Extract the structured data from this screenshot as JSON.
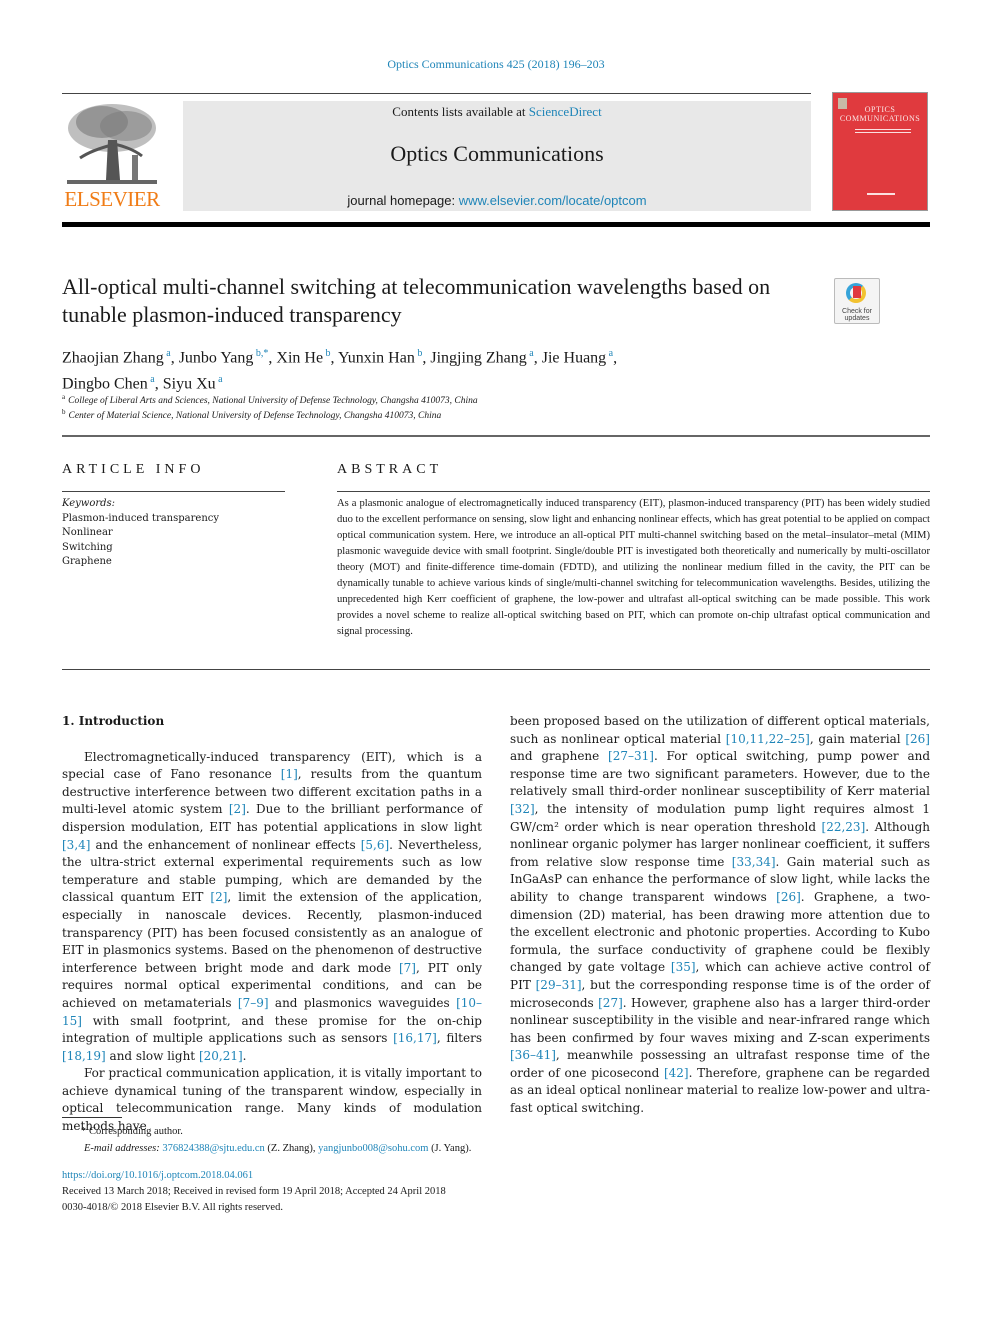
{
  "header": {
    "journal_ref": "Optics Communications 425 (2018) 196–203",
    "contents_prefix": "Contents lists available at ",
    "contents_link": "ScienceDirect",
    "journal_title": "Optics Communications",
    "homepage_prefix": "journal homepage: ",
    "homepage_link": "www.elsevier.com/locate/optcom",
    "publisher_logo": "ELSEVIER",
    "cover_title_line1": "OPTICS",
    "cover_title_line2": "COMMUNICATIONS"
  },
  "crossmark": {
    "label_line1": "Check for",
    "label_line2": "updates"
  },
  "article": {
    "title": "All-optical multi-channel switching at telecommunication wavelengths based on tunable plasmon-induced transparency",
    "authors": [
      {
        "name": "Zhaojian Zhang",
        "aff": "a"
      },
      {
        "name": "Junbo Yang",
        "aff": "b,*"
      },
      {
        "name": "Xin He",
        "aff": "b"
      },
      {
        "name": "Yunxin Han",
        "aff": "b"
      },
      {
        "name": "Jingjing Zhang",
        "aff": "a"
      },
      {
        "name": "Jie Huang",
        "aff": "a"
      },
      {
        "name": "Dingbo Chen",
        "aff": "a"
      },
      {
        "name": "Siyu Xu",
        "aff": "a"
      }
    ],
    "affiliations": [
      {
        "mark": "a",
        "text": "College of Liberal Arts and Sciences, National University of Defense Technology, Changsha 410073, China"
      },
      {
        "mark": "b",
        "text": "Center of Material Science, National University of Defense Technology, Changsha 410073, China"
      }
    ]
  },
  "article_info": {
    "heading": "ARTICLE INFO",
    "keywords_label": "Keywords:",
    "keywords": [
      "Plasmon-induced transparency",
      "Nonlinear",
      "Switching",
      "Graphene"
    ]
  },
  "abstract": {
    "heading": "ABSTRACT",
    "text": "As a plasmonic analogue of electromagnetically induced transparency (EIT), plasmon-induced transparency (PIT) has been widely studied duo to the excellent performance on sensing, slow light and enhancing nonlinear effects, which has great potential to be applied on compact optical communication system. Here, we introduce an all-optical PIT multi-channel switching based on the metal–insulator–metal (MIM) plasmonic waveguide device with small footprint. Single/double PIT is investigated both theoretically and numerically by multi-oscillator theory (MOT) and finite-difference time-domain (FDTD), and utilizing the nonlinear medium filled in the cavity, the PIT can be dynamically tunable to achieve various kinds of single/multi-channel switching for telecommunication wavelengths. Besides, utilizing the unprecedented high Kerr coefficient of graphene, the low-power and ultrafast all-optical switching can be made possible. This work provides a novel scheme to realize all-optical switching based on PIT, which can promote on-chip ultrafast optical communication and signal processing."
  },
  "body": {
    "section_heading": "1.  Introduction",
    "left_paragraphs": [
      [
        {
          "t": "Electromagnetically-induced transparency (EIT), which is a special case of Fano resonance "
        },
        {
          "c": "[1]"
        },
        {
          "t": ", results from the quantum destructive interference between two different excitation paths in a multi-level atomic system "
        },
        {
          "c": "[2]"
        },
        {
          "t": ". Due to the brilliant performance of dispersion modulation, EIT has potential applications in slow light "
        },
        {
          "c": "[3,4]"
        },
        {
          "t": " and the enhancement of nonlinear effects "
        },
        {
          "c": "[5,6]"
        },
        {
          "t": ". Nevertheless, the ultra-strict external experimental requirements such as low temperature and stable pumping, which are demanded by the classical quantum EIT "
        },
        {
          "c": "[2]"
        },
        {
          "t": ", limit the extension of the application, especially in nanoscale devices. Recently, plasmon-induced transparency (PIT) has been focused consistently as an analogue of EIT in plasmonics systems. Based on the phenomenon of destructive interference between bright mode and dark mode "
        },
        {
          "c": "[7]"
        },
        {
          "t": ", PIT only requires normal optical experimental conditions, and can be achieved on metamaterials "
        },
        {
          "c": "[7–9]"
        },
        {
          "t": " and plasmonics waveguides "
        },
        {
          "c": "[10–15]"
        },
        {
          "t": " with small footprint, and these promise for the on-chip integration of multiple applications such as sensors "
        },
        {
          "c": "[16,17]"
        },
        {
          "t": ", filters "
        },
        {
          "c": "[18,19]"
        },
        {
          "t": " and slow light "
        },
        {
          "c": "[20,21]"
        },
        {
          "t": "."
        }
      ],
      [
        {
          "t": "For practical communication application, it is vitally important to achieve dynamical tuning of the transparent window, especially in optical telecommunication range. Many kinds of modulation methods have"
        }
      ]
    ],
    "right_paragraphs": [
      [
        {
          "t": "been proposed based on the utilization of different optical materials, such as nonlinear optical material "
        },
        {
          "c": "[10,11,22–25]"
        },
        {
          "t": ", gain material "
        },
        {
          "c": "[26]"
        },
        {
          "t": " and graphene "
        },
        {
          "c": "[27–31]"
        },
        {
          "t": ". For optical switching, pump power and response time are two significant parameters. However, due to the relatively small third-order nonlinear susceptibility of Kerr material "
        },
        {
          "c": "[32]"
        },
        {
          "t": ", the intensity of modulation pump light requires almost 1 GW/cm² order which is near operation threshold "
        },
        {
          "c": "[22,23]"
        },
        {
          "t": ". Although nonlinear organic polymer has larger nonlinear coefficient, it suffers from relative slow response time "
        },
        {
          "c": "[33,34]"
        },
        {
          "t": ". Gain material such as InGaAsP can enhance the performance of slow light, while lacks the ability to change transparent windows "
        },
        {
          "c": "[26]"
        },
        {
          "t": ". Graphene, a two-dimension (2D) material, has been drawing more attention due to the excellent electronic and photonic properties. According to Kubo formula, the surface conductivity of graphene could be flexibly changed by gate voltage "
        },
        {
          "c": "[35]"
        },
        {
          "t": ", which can achieve active control of PIT "
        },
        {
          "c": "[29–31]"
        },
        {
          "t": ", but the corresponding response time is of the order of microseconds "
        },
        {
          "c": "[27]"
        },
        {
          "t": ". However, graphene also has a larger third-order nonlinear susceptibility in the visible and near-infrared range which has been confirmed by four waves mixing and Z-scan experiments "
        },
        {
          "c": "[36–41]"
        },
        {
          "t": ", meanwhile possessing an ultrafast response time of the order of one picosecond "
        },
        {
          "c": "[42]"
        },
        {
          "t": ". Therefore, graphene can be regarded as an ideal optical nonlinear material to realize low-power and ultra-fast optical switching."
        }
      ]
    ]
  },
  "footnotes": {
    "star": "*",
    "corresponding": "Corresponding author.",
    "email_label": "E-mail addresses:",
    "email1": "376824388@sjtu.edu.cn",
    "email1_owner": " (Z. Zhang), ",
    "email2": "yangjunbo008@sohu.com",
    "email2_owner": " (J. Yang).",
    "doi": "https://doi.org/10.1016/j.optcom.2018.04.061",
    "history": "Received 13 March 2018; Received in revised form 19 April 2018; Accepted 24 April 2018",
    "copyright": "0030-4018/© 2018 Elsevier B.V. All rights reserved."
  },
  "colors": {
    "link": "#1f85b8",
    "elsevier_orange": "#f07c16",
    "cover_red": "#e03a3e",
    "banner_gray": "#e8e8e8"
  }
}
